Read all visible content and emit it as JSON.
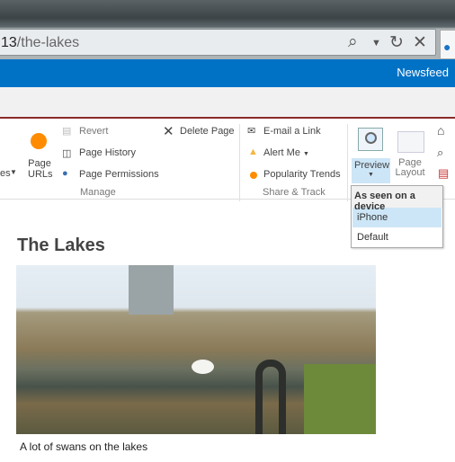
{
  "browser": {
    "url_host_tail": "13",
    "url_path": "/the-lakes",
    "icons": [
      "search-icon",
      "dropdown-icon",
      "refresh-icon",
      "stop-icon"
    ]
  },
  "suitebar": {
    "newsfeed": "Newsfeed",
    "color": "#0072c6"
  },
  "ribbon": {
    "partial_label": "es",
    "page_urls": "Page URLs",
    "manage": {
      "revert": "Revert",
      "page_history": "Page History",
      "page_permissions": "Page Permissions",
      "delete_page": "Delete Page",
      "group": "Manage"
    },
    "share": {
      "email": "E-mail a Link",
      "alert": "Alert Me",
      "popularity": "Popularity Trends",
      "group": "Share & Track"
    },
    "preview": "Preview",
    "page_layout": "Page Layout"
  },
  "preview_menu": {
    "header": "As seen on a device",
    "items": [
      "iPhone",
      "Default"
    ],
    "selected": "iPhone"
  },
  "content": {
    "title": "The Lakes",
    "caption": "A lot of swans on the lakes"
  }
}
